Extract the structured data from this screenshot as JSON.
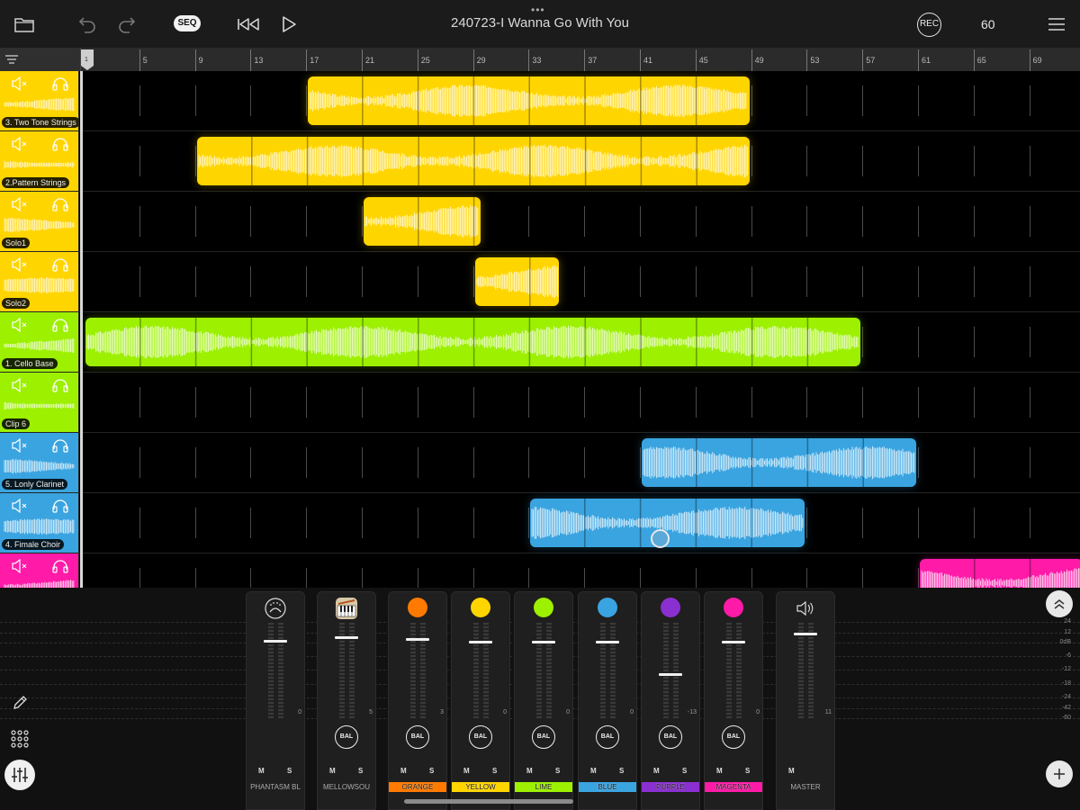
{
  "project": {
    "title": "240723-I Wanna Go With You",
    "tempo": "60"
  },
  "toolbar": {
    "seq_label": "SEQ",
    "rec_label": "REC",
    "grab_dots": "•••"
  },
  "ruler": {
    "marks": [
      "1",
      "5",
      "9",
      "13",
      "17",
      "21",
      "25",
      "29",
      "33",
      "37",
      "41",
      "45",
      "49",
      "53",
      "57",
      "61",
      "65",
      "69"
    ]
  },
  "colors": {
    "yellow": "#ffd500",
    "lime": "#9cf000",
    "blue": "#3aa4e0",
    "magenta": "#ff1aa8",
    "orange": "#ff7a00",
    "purple": "#8a2fd0"
  },
  "tracks": [
    {
      "name": "3. Two Tone Strings",
      "color": "yellow",
      "clips": [
        {
          "start": 17,
          "bars": 8
        }
      ]
    },
    {
      "name": "2.Pattern Strings",
      "color": "yellow",
      "clips": [
        {
          "start": 9,
          "bars": 10
        }
      ]
    },
    {
      "name": "Solo1",
      "color": "yellow",
      "clips": [
        {
          "start": 21,
          "bars": 2.17
        }
      ]
    },
    {
      "name": "Solo2",
      "color": "yellow",
      "clips": [
        {
          "start": 29,
          "bars": 1.58
        }
      ]
    },
    {
      "name": "1. Cello Base",
      "color": "lime",
      "clips": [
        {
          "start": 1,
          "bars": 14
        }
      ]
    },
    {
      "name": "Clip 6",
      "color": "lime",
      "clips": []
    },
    {
      "name": "5. Lonly Clarinet",
      "color": "blue",
      "clips": [
        {
          "start": 41,
          "bars": 5
        }
      ]
    },
    {
      "name": "4. Fimale Choir",
      "color": "blue",
      "clips": [
        {
          "start": 33,
          "bars": 5
        }
      ]
    },
    {
      "name": "",
      "color": "magenta",
      "clips": [
        {
          "start": 61,
          "bars": 3
        }
      ]
    }
  ],
  "mixer": {
    "db_scale": [
      "24",
      "12",
      "0dB",
      "-6",
      "-12",
      "-18",
      "-24",
      "-42",
      "-60"
    ],
    "bal_label": "BAL",
    "mute_label": "M",
    "solo_label": "S",
    "channels": [
      {
        "name": "PHANTASM BL",
        "icon": "synth-icon",
        "color": "",
        "fader": 0.82,
        "value": "0",
        "bal": false
      },
      {
        "name": "MELLOWSOU",
        "icon": "piano-app-icon",
        "color": "",
        "fader": 0.86,
        "value": "5",
        "bal": true
      },
      {
        "name": "ORANGE",
        "icon": "",
        "color": "#ff7a00",
        "fader": 0.84,
        "value": "3",
        "bal": true
      },
      {
        "name": "YELLOW",
        "icon": "",
        "color": "#ffd500",
        "fader": 0.81,
        "value": "0",
        "bal": true
      },
      {
        "name": "LIME",
        "icon": "",
        "color": "#9cf000",
        "fader": 0.81,
        "value": "0",
        "bal": true
      },
      {
        "name": "BLUE",
        "icon": "",
        "color": "#3aa4e0",
        "fader": 0.81,
        "value": "0",
        "bal": true
      },
      {
        "name": "PURPLE",
        "icon": "",
        "color": "#8a2fd0",
        "fader": 0.47,
        "value": "-13",
        "bal": true
      },
      {
        "name": "MAGENTA",
        "icon": "",
        "color": "#ff1aa8",
        "fader": 0.81,
        "value": "0",
        "bal": true
      },
      {
        "name": "MASTER",
        "icon": "speaker-icon",
        "color": "",
        "fader": 0.9,
        "value": "11",
        "bal": false
      }
    ]
  }
}
